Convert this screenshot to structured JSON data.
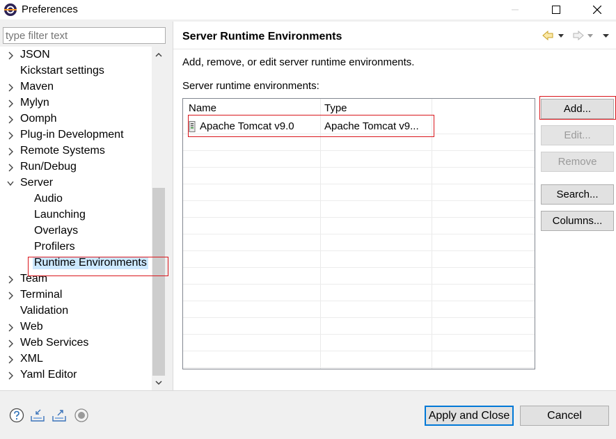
{
  "window": {
    "title": "Preferences"
  },
  "filter": {
    "placeholder": "type filter text"
  },
  "tree": [
    {
      "label": "JSON",
      "expandable": true
    },
    {
      "label": "Kickstart settings",
      "expandable": false
    },
    {
      "label": "Maven",
      "expandable": true
    },
    {
      "label": "Mylyn",
      "expandable": true
    },
    {
      "label": "Oomph",
      "expandable": true
    },
    {
      "label": "Plug-in Development",
      "expandable": true
    },
    {
      "label": "Remote Systems",
      "expandable": true
    },
    {
      "label": "Run/Debug",
      "expandable": true
    },
    {
      "label": "Server",
      "expandable": true,
      "expanded": true
    },
    {
      "label": "Audio",
      "child": true
    },
    {
      "label": "Launching",
      "child": true
    },
    {
      "label": "Overlays",
      "child": true
    },
    {
      "label": "Profilers",
      "child": true
    },
    {
      "label": "Runtime Environments",
      "child": true,
      "selected": true
    },
    {
      "label": "Team",
      "expandable": true
    },
    {
      "label": "Terminal",
      "expandable": true
    },
    {
      "label": "Validation",
      "expandable": false
    },
    {
      "label": "Web",
      "expandable": true
    },
    {
      "label": "Web Services",
      "expandable": true
    },
    {
      "label": "XML",
      "expandable": true
    },
    {
      "label": "Yaml Editor",
      "expandable": true
    }
  ],
  "page": {
    "title": "Server Runtime Environments",
    "description": "Add, remove, or edit server runtime environments.",
    "list_label": "Server runtime environments:",
    "columns": [
      "Name",
      "Type"
    ],
    "rows": [
      {
        "name": "Apache Tomcat v9.0",
        "type": "Apache Tomcat v9..."
      }
    ]
  },
  "buttons": {
    "add": "Add...",
    "edit": "Edit...",
    "remove": "Remove",
    "search": "Search...",
    "columns": "Columns..."
  },
  "footer": {
    "apply_close": "Apply and Close",
    "cancel": "Cancel"
  },
  "colors": {
    "selection": "#cce8ff",
    "annotation": "#d9151b",
    "default_button_border": "#0078d7"
  }
}
